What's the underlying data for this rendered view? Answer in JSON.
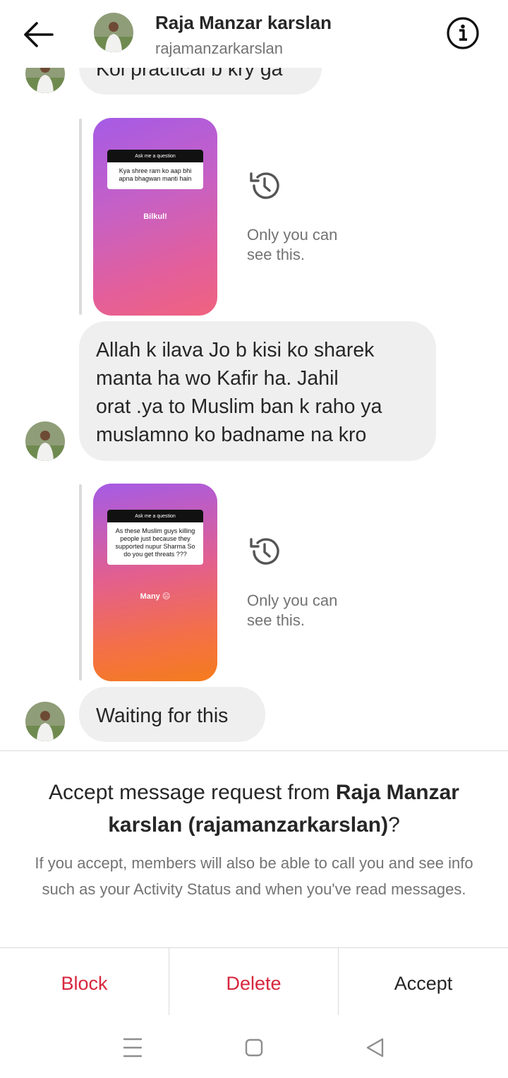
{
  "header": {
    "name": "Raja Manzar karslan",
    "username": "rajamanzarkarslan"
  },
  "messages": {
    "partial": "Koi practical b kry ga",
    "msg1": [
      "Allah k ilava Jo b kisi ko sharek",
      "manta ha wo Kafir ha. Jahil",
      "orat .ya to Muslim ban k raho ya",
      "muslamno ko badname na kro"
    ],
    "msg2": "Waiting for this"
  },
  "stories": [
    {
      "header": "Ask me a question",
      "question": "Kya shree ram ko aap bhi apna bhagwan manti hain",
      "answer": "Bilkul!",
      "note": [
        "Only you can",
        "see this."
      ]
    },
    {
      "header": "Ask me a question",
      "question": "As these Muslim guys killing people just because they supported nupur Sharma So do you get threats ???",
      "answer": "Many 😐",
      "note": [
        "Only you can",
        "see this."
      ]
    }
  ],
  "request": {
    "title_prefix": "Accept message request from ",
    "title_bold": "Raja Manzar karslan (rajamanzarkarslan)",
    "title_suffix": "?",
    "description": "If you accept, members will also be able to call you and see info such as your Activity Status and when you've read messages."
  },
  "actions": {
    "block": "Block",
    "delete": "Delete",
    "accept": "Accept"
  },
  "colors": {
    "danger": "#d7263d",
    "bubble": "#efefef",
    "muted": "#737373"
  },
  "icons": [
    "back-arrow-icon",
    "info-icon",
    "history-icon",
    "menu-lines-icon",
    "home-square-icon",
    "back-triangle-icon"
  ]
}
